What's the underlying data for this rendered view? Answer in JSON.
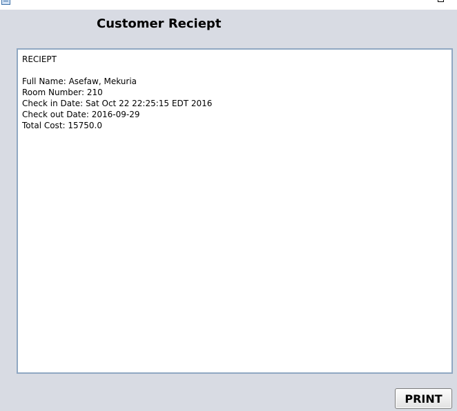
{
  "window": {
    "heading": "Customer Reciept",
    "icons": {
      "app": "app-window-icon",
      "maximize": "maximize-icon"
    }
  },
  "receipt": {
    "title": "RECIEPT",
    "lines": {
      "full_name": "Full Name: Asefaw, Mekuria",
      "room_number": "Room Number: 210",
      "check_in": "Check in Date: Sat Oct 22 22:25:15 EDT 2016",
      "check_out": "Check out Date: 2016-09-29",
      "total_cost": "Total Cost: 15750.0"
    }
  },
  "actions": {
    "print_label": "PRINT"
  },
  "colors": {
    "background": "#d8dbe3",
    "panel_border": "#8fa7c2",
    "panel_background": "#ffffff"
  }
}
